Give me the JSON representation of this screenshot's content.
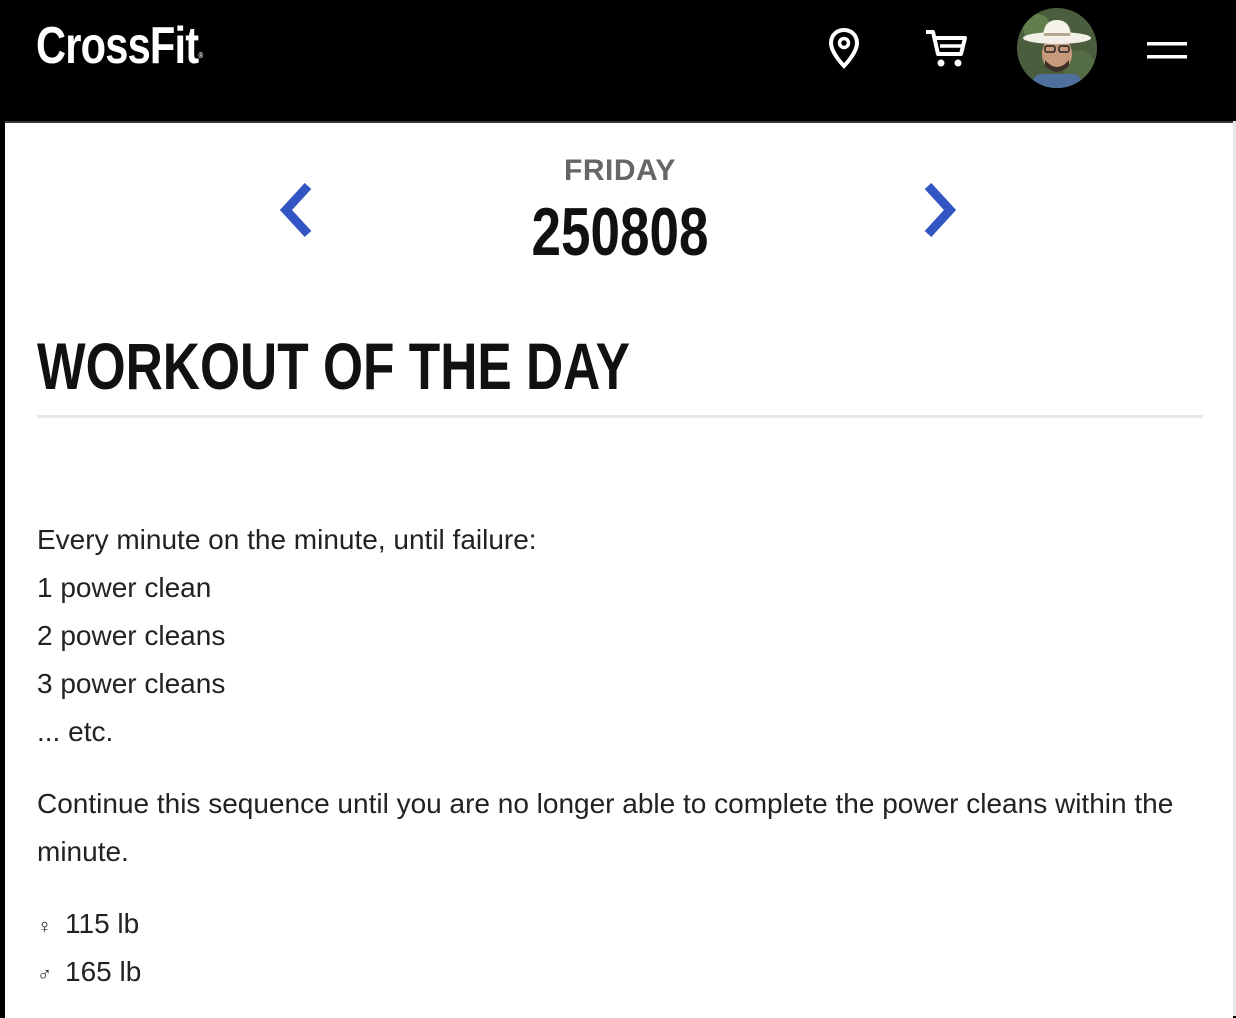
{
  "header": {
    "logo": "CrossFit",
    "logo_mark": "®",
    "icons": [
      "location-pin-icon",
      "shopping-cart-icon",
      "avatar",
      "hamburger-menu-icon"
    ]
  },
  "day_nav": {
    "day_name": "FRIDAY",
    "date_code": "250808"
  },
  "workout": {
    "title": "WORKOUT OF THE DAY",
    "lines": [
      "Every minute on the minute, until failure:",
      "1 power clean",
      "2 power cleans",
      "3 power cleans",
      "... etc."
    ],
    "paragraph": "Continue this sequence until you are no longer able to complete the power cleans within the minute.",
    "weights": [
      {
        "symbol": "♀",
        "value": "115 lb"
      },
      {
        "symbol": "♂",
        "value": "165 lb"
      }
    ]
  },
  "colors": {
    "header_bg": "#000000",
    "accent_blue": "#3355c4",
    "text": "#222222",
    "muted": "#666666"
  }
}
